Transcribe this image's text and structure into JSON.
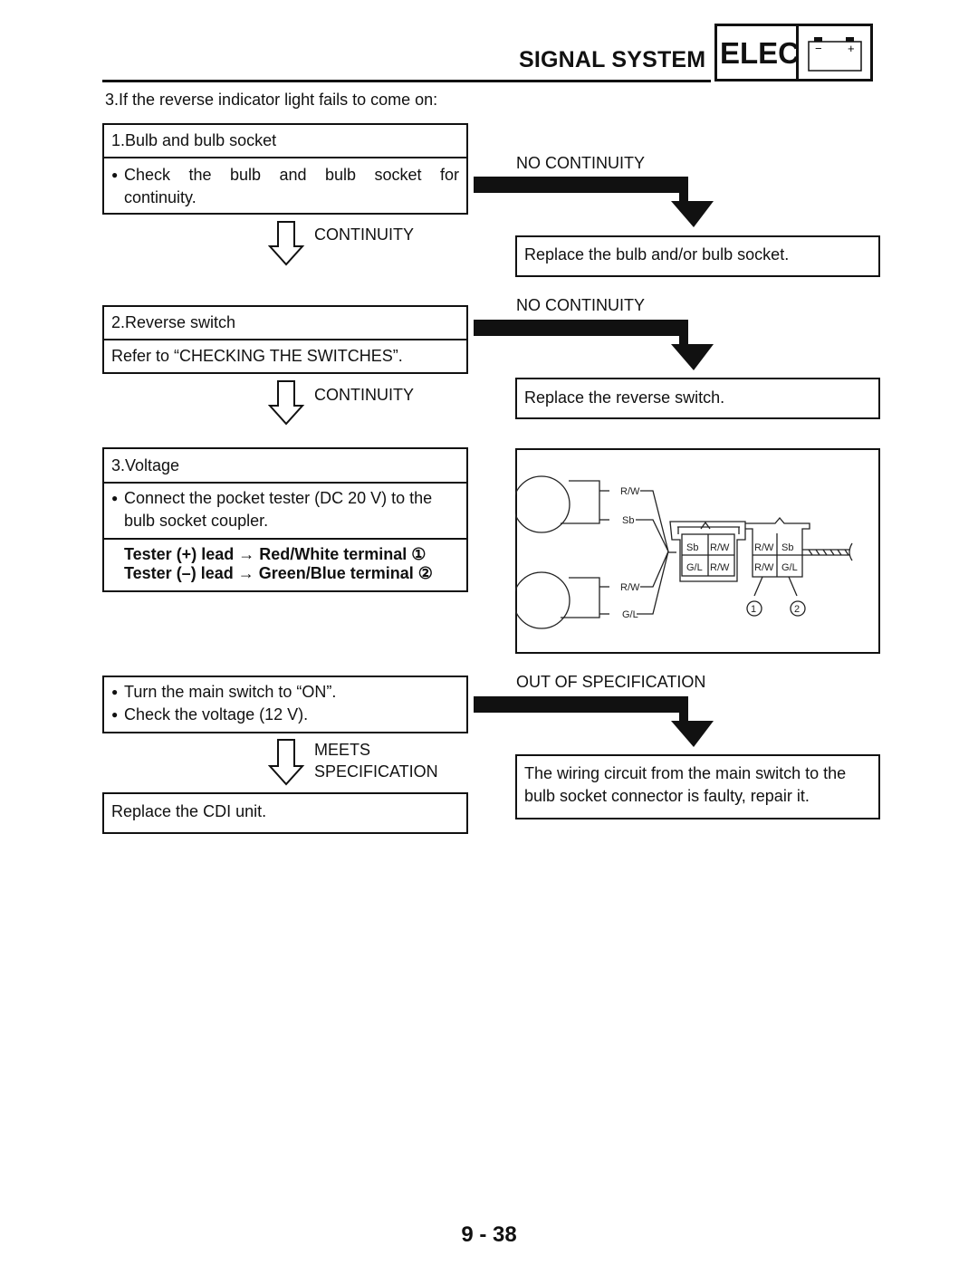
{
  "header": {
    "section_title": "SIGNAL SYSTEM",
    "chapter_tag": "ELEC",
    "battery_icon_minus": "−",
    "battery_icon_plus": "+"
  },
  "intro": "3.If the reverse indicator light fails to come on:",
  "steps": [
    {
      "title": "1.Bulb and bulb socket",
      "bullets": [
        "Check the bulb and bulb socket for",
        "continuity."
      ],
      "pass_label": "CONTINUITY",
      "fail_label": "NO CONTINUITY",
      "fail_action": "Replace the bulb and/or bulb socket."
    },
    {
      "title": "2.Reverse switch",
      "note": "Refer to “CHECKING THE SWITCHES”.",
      "pass_label": "CONTINUITY",
      "fail_label": "NO CONTINUITY",
      "fail_action": "Replace the reverse switch."
    },
    {
      "title": "3.Voltage",
      "bullets": [
        "Connect the pocket tester (DC 20 V) to the",
        "bulb socket coupler."
      ],
      "tester_lines": [
        "Tester (+) lead → Red/White terminal ①",
        "Tester (–) lead → Green/Blue terminal ②"
      ]
    },
    {
      "bullets": [
        "Turn the main switch to “ON”.",
        "Check the voltage (12 V)."
      ],
      "pass_label_line1": "MEETS",
      "pass_label_line2": "SPECIFICATION",
      "pass_action": "Replace the CDI unit.",
      "fail_label": "OUT OF SPECIFICATION",
      "fail_action_line1": "The wiring circuit from the main switch to the",
      "fail_action_line2": "bulb socket connector is faulty, repair it."
    }
  ],
  "diagram": {
    "bulb1_wires": [
      "R/W",
      "Sb"
    ],
    "bulb2_wires": [
      "R/W",
      "G/L"
    ],
    "coupler_left": [
      "Sb",
      "R/W",
      "G/L",
      "R/W"
    ],
    "coupler_right": [
      "R/W",
      "Sb",
      "R/W",
      "G/L"
    ],
    "callouts": [
      "①",
      "②"
    ]
  },
  "page_number": "9 - 38"
}
